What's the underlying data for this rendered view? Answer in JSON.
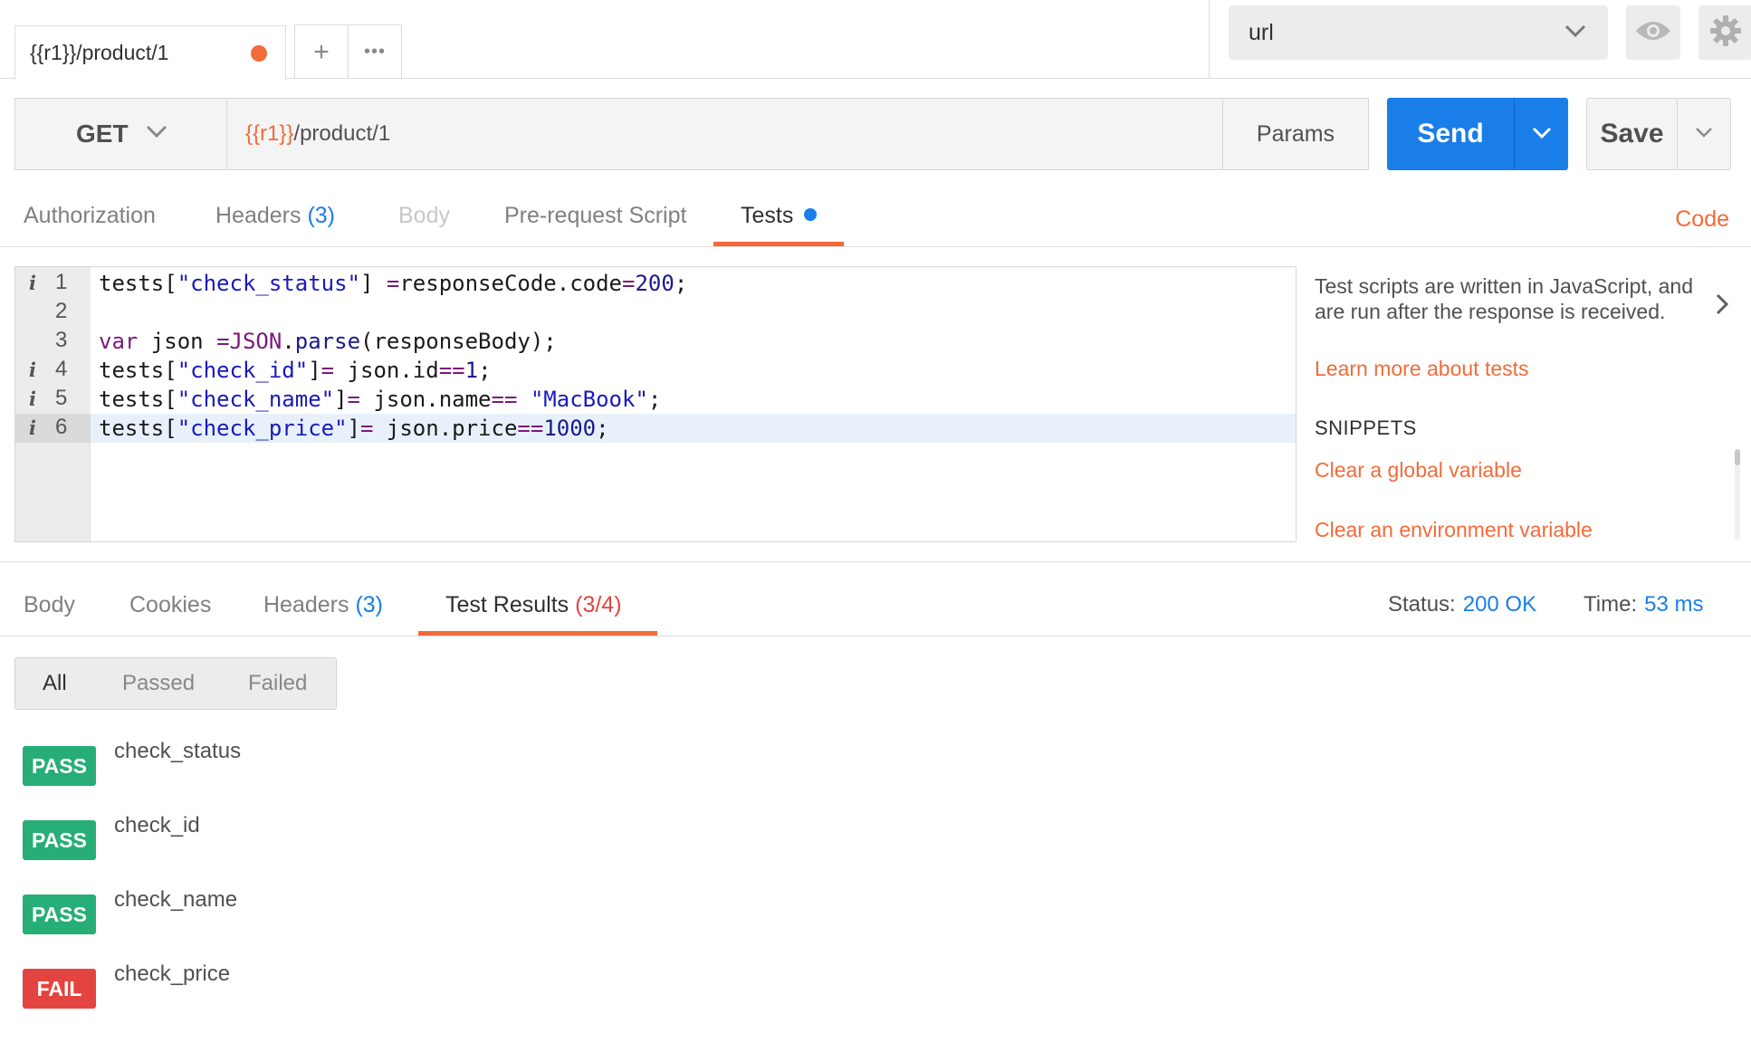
{
  "top": {
    "request_tab_label": "{{r1}}/product/1",
    "new_tab": "+",
    "more_tabs": "•••",
    "environment": "url"
  },
  "request": {
    "method": "GET",
    "url_var": "{{r1}}",
    "url_path": "/product/1",
    "params_label": "Params",
    "send_label": "Send",
    "save_label": "Save"
  },
  "request_tabs": {
    "authorization": "Authorization",
    "headers": "Headers",
    "headers_count": "(3)",
    "body": "Body",
    "pre_request": "Pre-request Script",
    "tests": "Tests",
    "code": "Code"
  },
  "editor": {
    "line_numbers": [
      "1",
      "2",
      "3",
      "4",
      "5",
      "6"
    ],
    "info_marker": "i",
    "lines": [
      "tests[\"check_status\"] =responseCode.code=200;",
      "",
      "var json =JSON.parse(responseBody);",
      "tests[\"check_id\"]= json.id==1;",
      "tests[\"check_name\"]= json.name== \"MacBook\";",
      "tests[\"check_price\"]= json.price==1000;"
    ]
  },
  "side_panel": {
    "description": "Test scripts are written in JavaScript, and are run after the response is received.",
    "learn_more": "Learn more about tests",
    "snippets_title": "SNIPPETS",
    "snippets": [
      "Clear a global variable",
      "Clear an environment variable"
    ]
  },
  "response": {
    "tabs": {
      "body": "Body",
      "cookies": "Cookies",
      "headers": "Headers",
      "headers_count": "(3)",
      "test_results": "Test Results",
      "test_results_count": "(3/4)"
    },
    "status_label": "Status:",
    "status_value": "200 OK",
    "time_label": "Time:",
    "time_value": "53 ms",
    "filters": [
      "All",
      "Passed",
      "Failed"
    ],
    "results": [
      {
        "status": "PASS",
        "name": "check_status"
      },
      {
        "status": "PASS",
        "name": "check_id"
      },
      {
        "status": "PASS",
        "name": "check_name"
      },
      {
        "status": "FAIL",
        "name": "check_price"
      }
    ]
  },
  "colors": {
    "accent_orange": "#f26b3a",
    "send_blue": "#1a7ee8",
    "pass_green": "#27ae76",
    "fail_red": "#e4443f"
  }
}
